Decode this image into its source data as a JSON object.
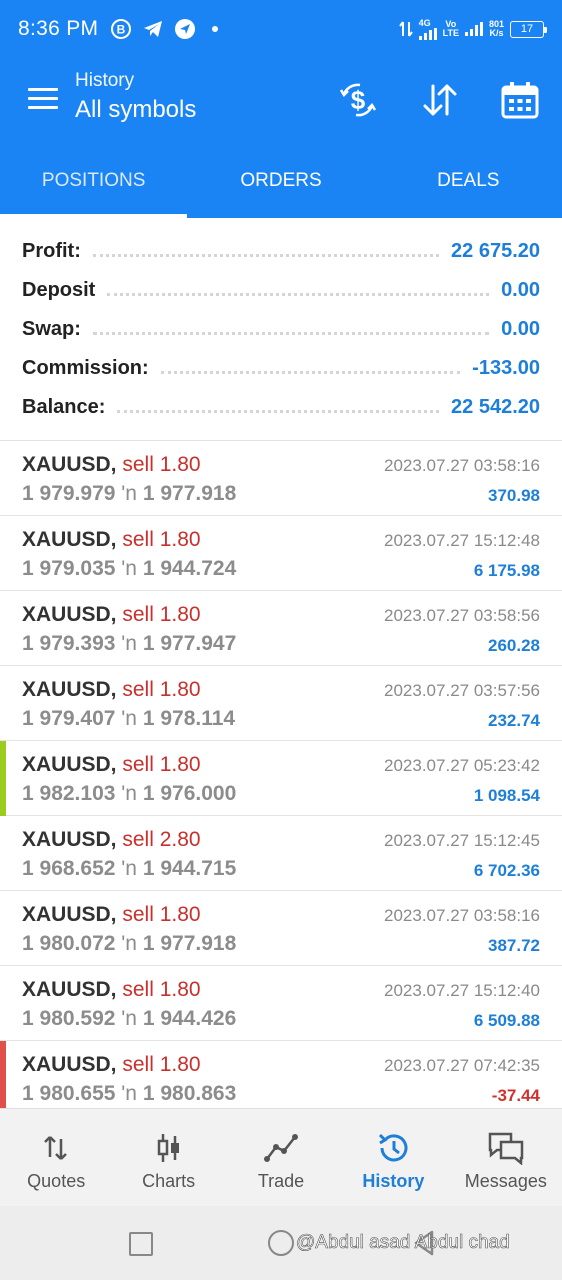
{
  "status_bar": {
    "time": "8:36 PM",
    "net_speed_top": "801",
    "net_speed_bottom": "K/s",
    "network_top": "4G",
    "volte_top": "Vo",
    "volte_bottom": "LTE",
    "battery": "17"
  },
  "app_bar": {
    "subtitle": "History",
    "title": "All symbols"
  },
  "tabs": [
    {
      "label": "POSITIONS",
      "active": true
    },
    {
      "label": "ORDERS",
      "active": false
    },
    {
      "label": "DEALS",
      "active": false
    }
  ],
  "summary": [
    {
      "label": "Profit:",
      "value": "22 675.20"
    },
    {
      "label": "Deposit",
      "value": "0.00"
    },
    {
      "label": "Swap:",
      "value": "0.00"
    },
    {
      "label": "Commission:",
      "value": "-133.00"
    },
    {
      "label": "Balance:",
      "value": "22 542.20"
    }
  ],
  "deals": [
    {
      "symbol": "XAUUSD,",
      "side": "sell 1.80",
      "time": "2023.07.27 03:58:16",
      "open": "1 979.979",
      "arrow": "'n",
      "close": "1 977.918",
      "profit": "370.98",
      "profit_color": "#1e7fd8",
      "marker": ""
    },
    {
      "symbol": "XAUUSD,",
      "side": "sell 1.80",
      "time": "2023.07.27 15:12:48",
      "open": "1 979.035",
      "arrow": "'n",
      "close": "1 944.724",
      "profit": "6 175.98",
      "profit_color": "#1e7fd8",
      "marker": ""
    },
    {
      "symbol": "XAUUSD,",
      "side": "sell 1.80",
      "time": "2023.07.27 03:58:56",
      "open": "1 979.393",
      "arrow": "'n",
      "close": "1 977.947",
      "profit": "260.28",
      "profit_color": "#1e7fd8",
      "marker": ""
    },
    {
      "symbol": "XAUUSD,",
      "side": "sell 1.80",
      "time": "2023.07.27 03:57:56",
      "open": "1 979.407",
      "arrow": "'n",
      "close": "1 978.114",
      "profit": "232.74",
      "profit_color": "#1e7fd8",
      "marker": ""
    },
    {
      "symbol": "XAUUSD,",
      "side": "sell 1.80",
      "time": "2023.07.27 05:23:42",
      "open": "1 982.103",
      "arrow": "'n",
      "close": "1 976.000",
      "profit": "1 098.54",
      "profit_color": "#1e7fd8",
      "marker": "#9ccc1f"
    },
    {
      "symbol": "XAUUSD,",
      "side": "sell 2.80",
      "time": "2023.07.27 15:12:45",
      "open": "1 968.652",
      "arrow": "'n",
      "close": "1 944.715",
      "profit": "6 702.36",
      "profit_color": "#1e7fd8",
      "marker": ""
    },
    {
      "symbol": "XAUUSD,",
      "side": "sell 1.80",
      "time": "2023.07.27 03:58:16",
      "open": "1 980.072",
      "arrow": "'n",
      "close": "1 977.918",
      "profit": "387.72",
      "profit_color": "#1e7fd8",
      "marker": ""
    },
    {
      "symbol": "XAUUSD,",
      "side": "sell 1.80",
      "time": "2023.07.27 15:12:40",
      "open": "1 980.592",
      "arrow": "'n",
      "close": "1 944.426",
      "profit": "6 509.88",
      "profit_color": "#1e7fd8",
      "marker": ""
    },
    {
      "symbol": "XAUUSD,",
      "side": "sell 1.80",
      "time": "2023.07.27 07:42:35",
      "open": "1 980.655",
      "arrow": "'n",
      "close": "1 980.863",
      "profit": "-37.44",
      "profit_color": "#d0312d",
      "marker": "#e0504a"
    }
  ],
  "bottom_nav": [
    {
      "label": "Quotes",
      "icon": "quotes-icon",
      "active": false
    },
    {
      "label": "Charts",
      "icon": "charts-icon",
      "active": false
    },
    {
      "label": "Trade",
      "icon": "trade-icon",
      "active": false
    },
    {
      "label": "History",
      "icon": "history-icon",
      "active": true
    },
    {
      "label": "Messages",
      "icon": "messages-icon",
      "active": false
    }
  ],
  "watermark": "@Abdul asad Abdul chad",
  "colors": {
    "primary": "#1b84f4",
    "profit_positive": "#1e7fd8",
    "profit_negative": "#d0312d",
    "sell": "#c9302c"
  }
}
